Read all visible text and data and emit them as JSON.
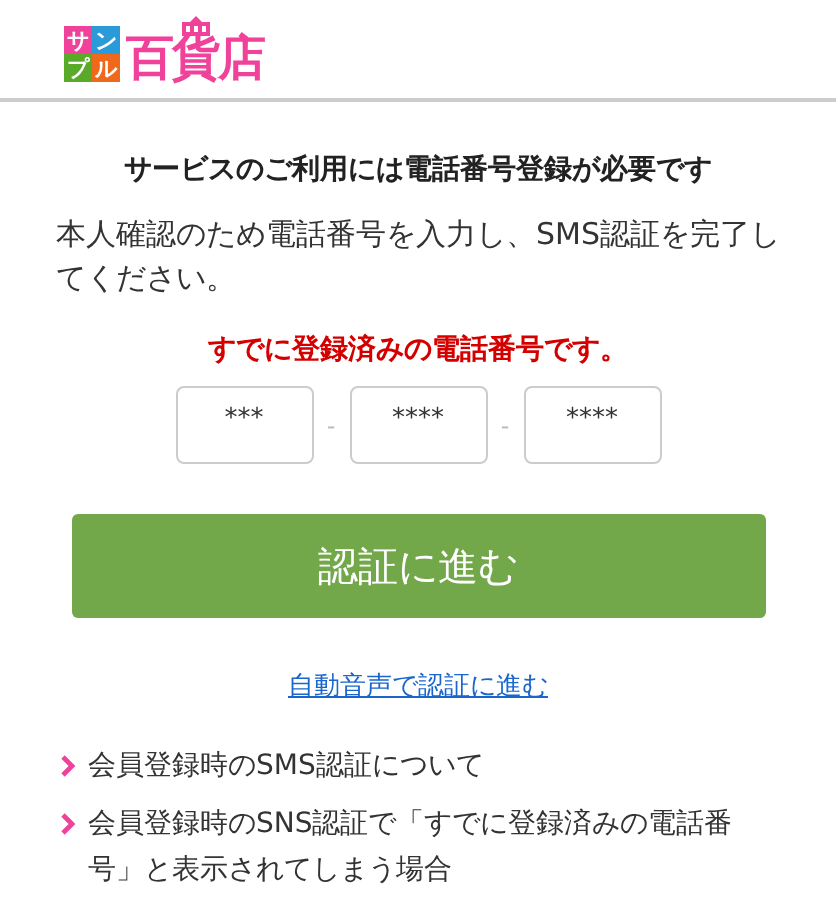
{
  "header": {
    "logo": {
      "tiles": [
        {
          "char": "サ",
          "color": "#f0429a"
        },
        {
          "char": "ン",
          "color": "#2a9ad8"
        },
        {
          "char": "プ",
          "color": "#5aaa2a"
        },
        {
          "char": "ル",
          "color": "#ee6a1a"
        }
      ],
      "name": "百貨店"
    }
  },
  "title": "サービスのご利用には電話番号登録が必要です",
  "description": "本人確認のため電話番号を入力し、SMS認証を完了してください。",
  "error": "すでに登録済みの電話番号です。",
  "phone_fields": [
    {
      "value": "***"
    },
    {
      "value": "****"
    },
    {
      "value": "****"
    }
  ],
  "separators": [
    "-",
    "-"
  ],
  "submit_button": "認証に進む",
  "voice_link": "自動音声で認証に進む",
  "help_links": [
    {
      "label": "会員登録時のSMS認証について"
    },
    {
      "label": "会員登録時のSNS認証で「すでに登録済みの電話番号」と表示されてしまう場合"
    }
  ]
}
